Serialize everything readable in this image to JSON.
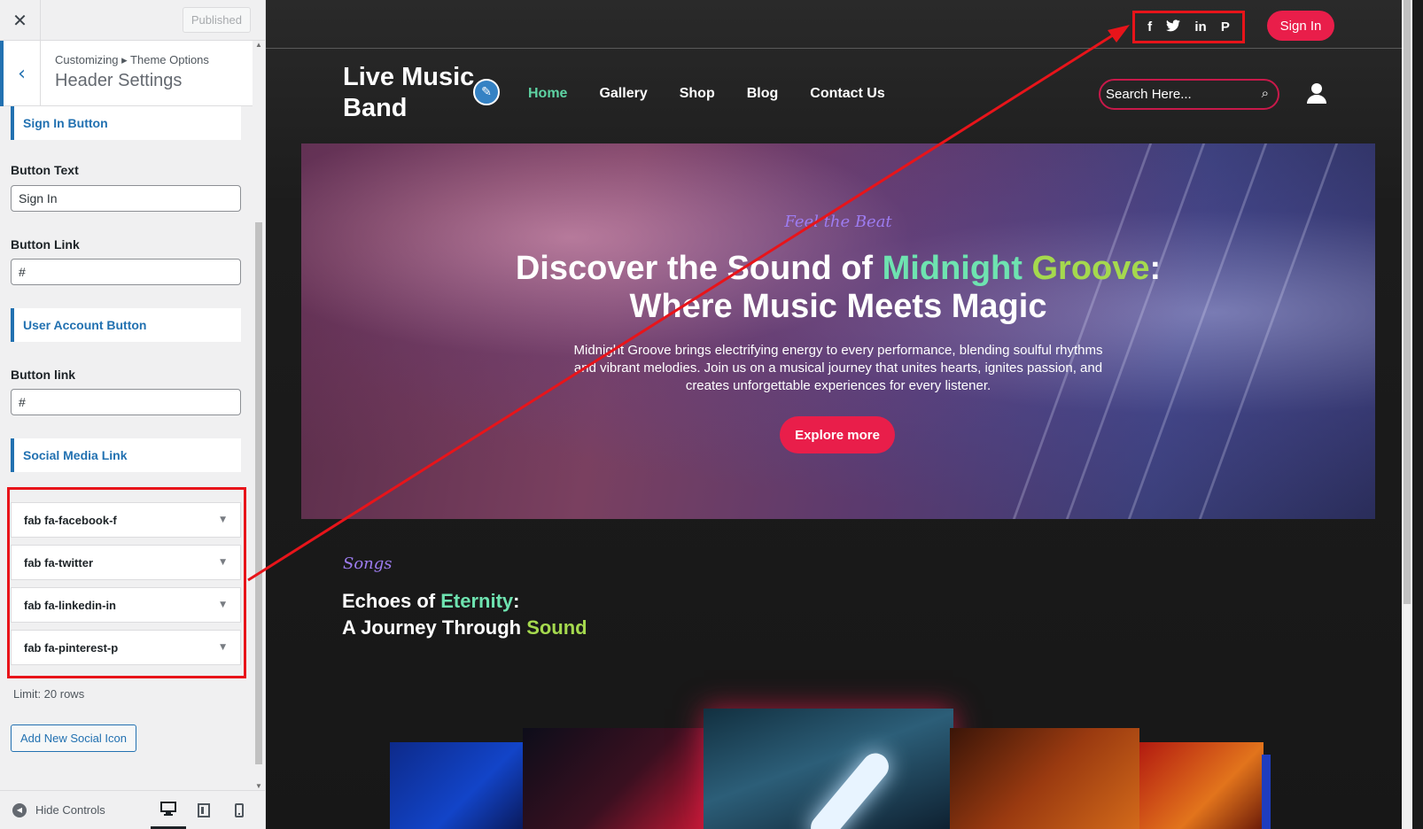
{
  "customizer": {
    "close_icon": "close-icon",
    "published_label": "Published",
    "breadcrumb": "Customizing ▸ Theme Options",
    "section_title": "Header Settings",
    "sign_in_heading": "Sign In Button",
    "button_text_label": "Button Text",
    "button_text_value": "Sign In",
    "button_link_label": "Button Link",
    "button_link_value": "#",
    "user_account_heading": "User Account Button",
    "user_button_link_label": "Button link",
    "user_button_link_value": "#",
    "social_heading": "Social Media Link",
    "social_items": [
      {
        "label": "fab fa-facebook-f"
      },
      {
        "label": "fab fa-twitter"
      },
      {
        "label": "fab fa-linkedin-in"
      },
      {
        "label": "fab fa-pinterest-p"
      }
    ],
    "limit_text": "Limit: 20 rows",
    "add_button": "Add New Social Icon",
    "hide_controls": "Hide Controls"
  },
  "preview": {
    "social_icons": [
      "f",
      "🐦",
      "in",
      "P"
    ],
    "social_icon_names": [
      "facebook-icon",
      "twitter-icon",
      "linkedin-icon",
      "pinterest-icon"
    ],
    "sign_in": "Sign In",
    "logo_line1": "Live Music",
    "logo_line2": "Band",
    "nav": [
      "Home",
      "Gallery",
      "Shop",
      "Blog",
      "Contact Us"
    ],
    "search_placeholder": "Search Here...",
    "hero": {
      "tagline": "Feel the Beat",
      "title_part1": "Discover the Sound of ",
      "title_highlight1": "Midnight ",
      "title_highlight2": "Groove",
      "title_part2": ":",
      "title_line2": "Where Music Meets Magic",
      "description": "Midnight Groove brings electrifying energy to every performance, blending soulful rhythms and vibrant melodies. Join us on a musical journey that unites hearts, ignites passion, and creates unforgettable experiences for every listener.",
      "button": "Explore more"
    },
    "songs": {
      "tagline": "Songs",
      "title_part1": "Echoes of ",
      "title_highlight1": "Eternity",
      "title_colon": ":",
      "title_part2": "A Journey Through ",
      "title_highlight2": "Sound"
    }
  },
  "colors": {
    "accent_pink": "#e91e4a",
    "accent_green": "#6ee3b0",
    "wp_blue": "#2271b1",
    "annotation_red": "#e8141a"
  }
}
